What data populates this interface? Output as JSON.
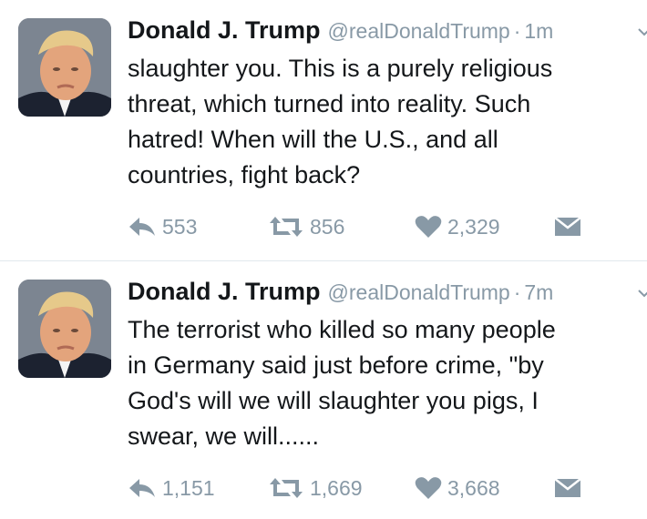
{
  "tweets": [
    {
      "author_name": "Donald J. Trump",
      "handle": "@realDonaldTrump",
      "separator": "·",
      "time": "1m",
      "text": "slaughter you. This is a purely religious\nthreat, which turned into reality. Such\nhatred! When will the U.S., and all\ncountries, fight back?",
      "replies": "553",
      "retweets": "856",
      "likes": "2,329"
    },
    {
      "author_name": "Donald J. Trump",
      "handle": "@realDonaldTrump",
      "separator": "·",
      "time": "7m",
      "text": "The terrorist who killed so many people\nin Germany said just before crime, \"by\nGod's will we will slaughter you pigs, I\nswear, we will......",
      "replies": "1,151",
      "retweets": "1,669",
      "likes": "3,668"
    }
  ],
  "colors": {
    "text": "#14171a",
    "muted": "#8899a6",
    "divider": "#e1e8ed"
  },
  "icons": [
    "reply-icon",
    "retweet-icon",
    "heart-icon",
    "direct-message-icon",
    "chevron-down-icon"
  ]
}
